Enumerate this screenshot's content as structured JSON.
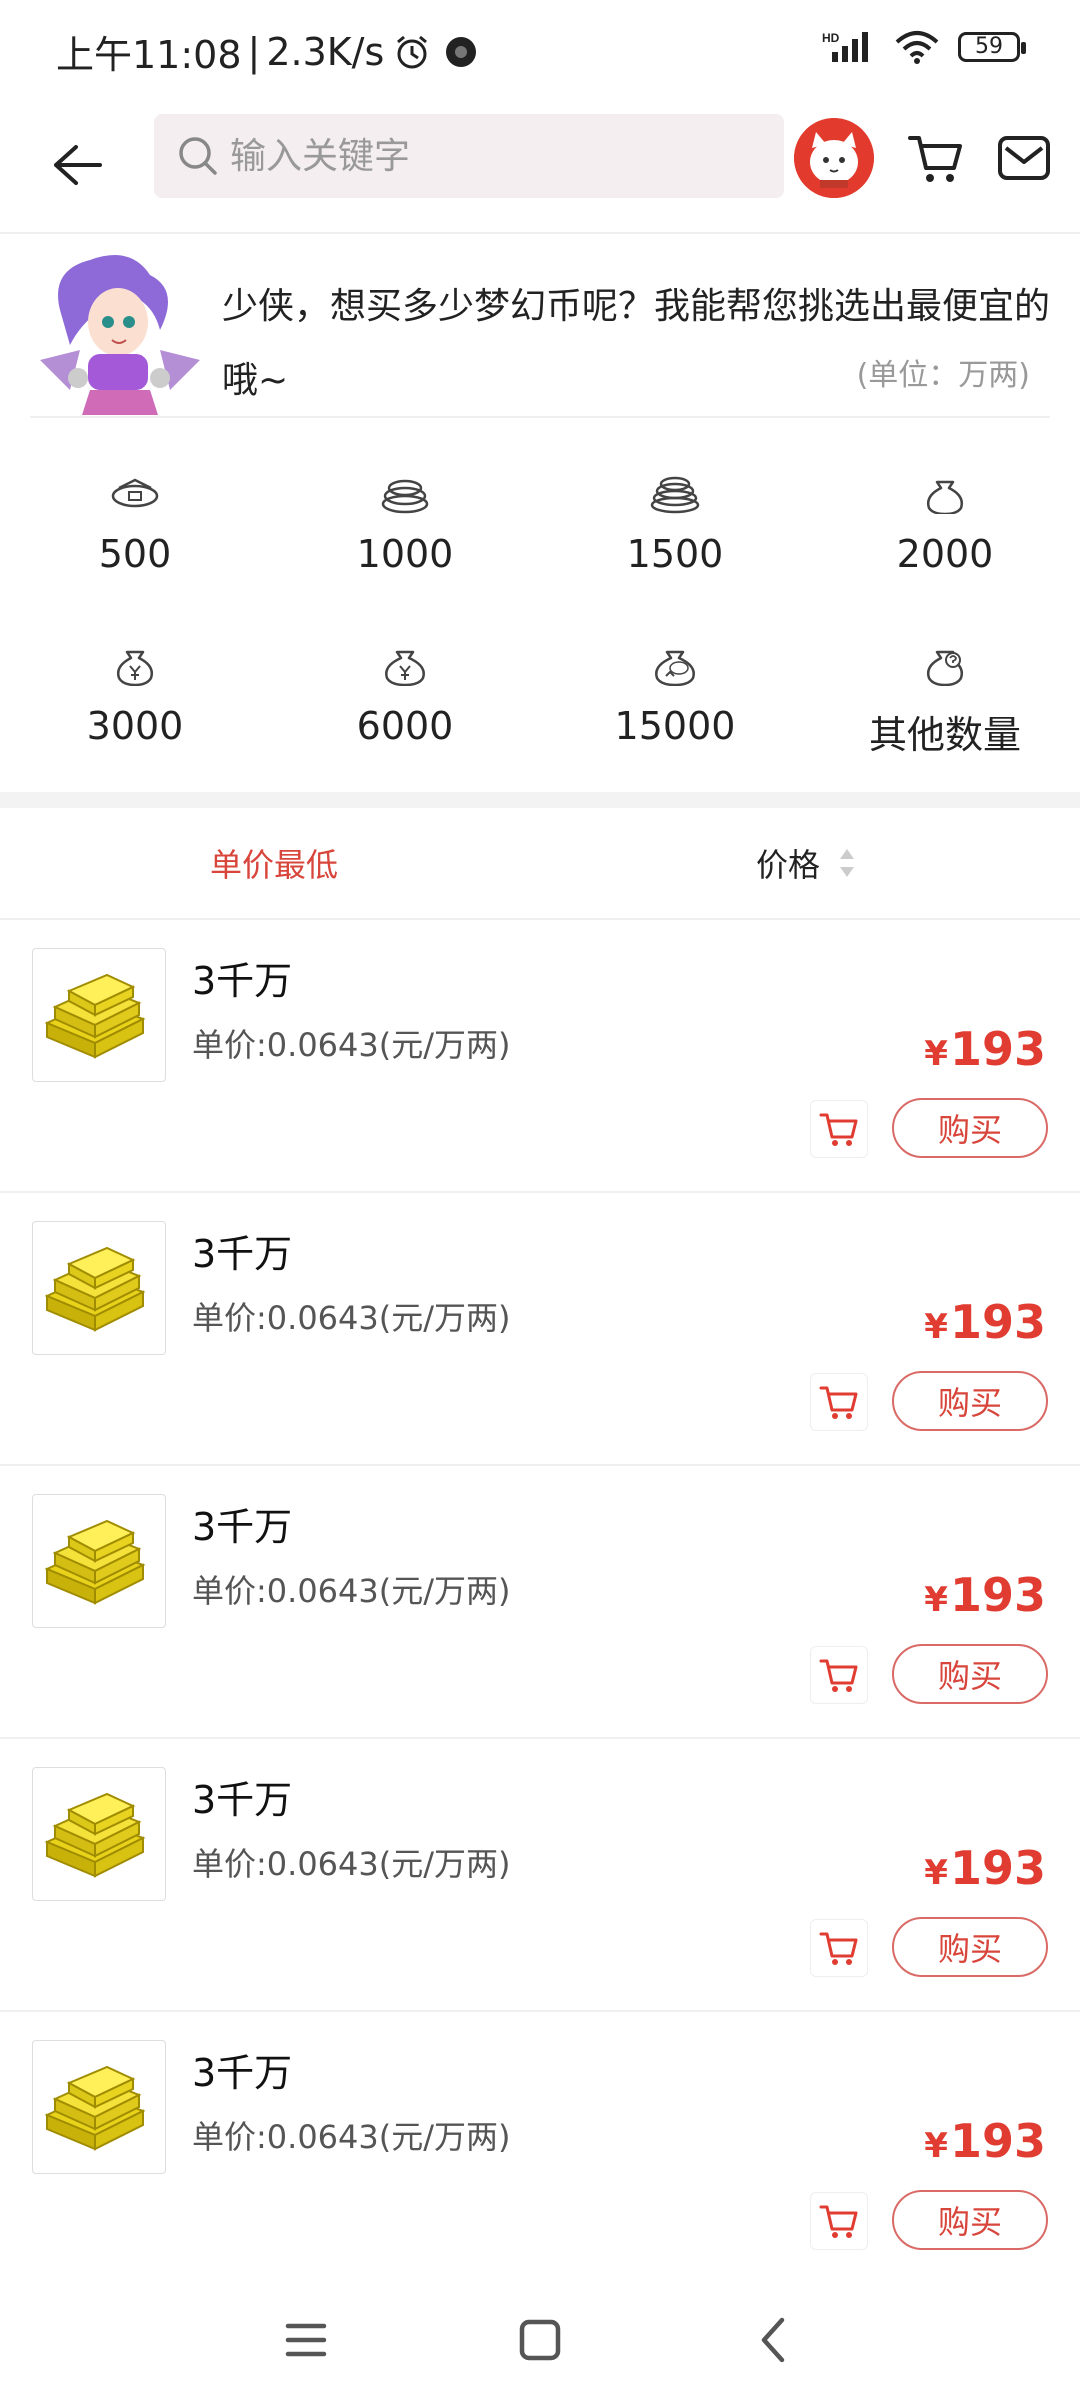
{
  "status_bar": {
    "time": "上午11:08",
    "sep": "|",
    "speed": "2.3K/s",
    "battery": "59",
    "network_tag": "HD"
  },
  "nav": {
    "search_placeholder": "输入关键字"
  },
  "intro": {
    "message": "少侠，想买多少梦幻币呢？我能帮您挑选出最便宜的哦~",
    "unit_note": "(单位：万两)"
  },
  "amounts": [
    {
      "label": "500",
      "icon": "coin-single-icon"
    },
    {
      "label": "1000",
      "icon": "coin-stack-icon"
    },
    {
      "label": "1500",
      "icon": "coin-pile-icon"
    },
    {
      "label": "2000",
      "icon": "money-bag-icon"
    },
    {
      "label": "3000",
      "icon": "money-bag-yen-icon"
    },
    {
      "label": "6000",
      "icon": "money-bag-yen-icon"
    },
    {
      "label": "15000",
      "icon": "money-bag-max-icon"
    },
    {
      "label": "其他数量",
      "icon": "money-bag-question-icon"
    }
  ],
  "sort": {
    "lowest_label": "单价最低",
    "price_label": "价格"
  },
  "products": [
    {
      "title": "3千万",
      "unit_price": "单价:0.0643(元/万两)",
      "currency": "¥",
      "price": "193",
      "buy_label": "购买"
    },
    {
      "title": "3千万",
      "unit_price": "单价:0.0643(元/万两)",
      "currency": "¥",
      "price": "193",
      "buy_label": "购买"
    },
    {
      "title": "3千万",
      "unit_price": "单价:0.0643(元/万两)",
      "currency": "¥",
      "price": "193",
      "buy_label": "购买"
    },
    {
      "title": "3千万",
      "unit_price": "单价:0.0643(元/万两)",
      "currency": "¥",
      "price": "193",
      "buy_label": "购买"
    },
    {
      "title": "3千万",
      "unit_price": "单价:0.0643(元/万两)",
      "currency": "¥",
      "price": "193",
      "buy_label": "购买"
    }
  ],
  "colors": {
    "accent": "#e03c31",
    "search_bg": "#f5eef1"
  }
}
